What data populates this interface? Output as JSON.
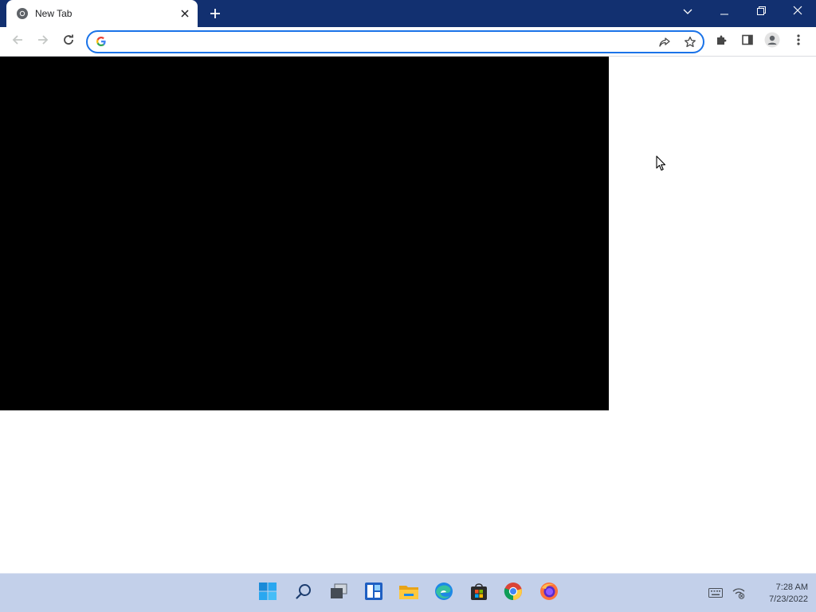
{
  "browser": {
    "tab": {
      "title": "New Tab",
      "favicon": "chrome-icon"
    },
    "window_controls": [
      "tab-search-icon",
      "minimize-icon",
      "restore-icon",
      "close-icon"
    ],
    "omnibox": {
      "value": "",
      "placeholder": "",
      "engine_icon": "google-g-icon"
    },
    "toolbar_icons": [
      "back-arrow-icon",
      "forward-arrow-icon",
      "reload-icon",
      "share-icon",
      "star-icon",
      "extensions-icon",
      "side-panel-icon",
      "profile-icon",
      "menu-icon"
    ]
  },
  "page": {
    "media_background": "#000000"
  },
  "taskbar": {
    "apps": [
      "start-icon",
      "search-icon",
      "task-view-icon",
      "widgets-icon",
      "file-explorer-icon",
      "edge-icon",
      "store-icon",
      "chrome-icon",
      "firefox-icon"
    ],
    "tray": [
      "keyboard-icon",
      "network-icon"
    ],
    "clock": {
      "time": "7:28 AM",
      "date": "7/23/2022"
    }
  },
  "colors": {
    "titlebar": "#123070",
    "omnibox_focus": "#1a73e8",
    "taskbar": "#c3d0ea"
  }
}
